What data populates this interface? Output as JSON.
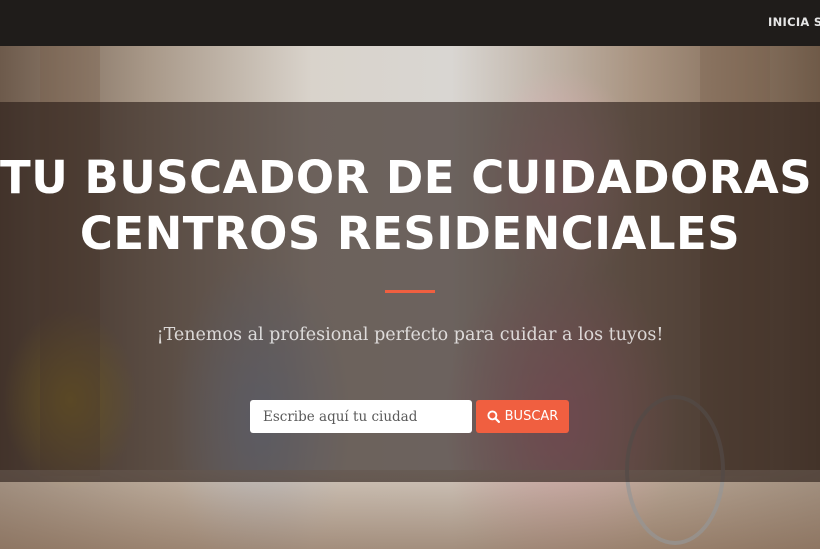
{
  "nav": {
    "link_label": "INICIA SESIÓN"
  },
  "hero": {
    "title_line1": "TU BUSCADOR DE CUIDADORAS Y",
    "title_line2": "CENTROS RESIDENCIALES",
    "subtitle": "¡Tenemos al profesional perfecto para cuidar a los tuyos!",
    "accent_color": "#f05f40"
  },
  "search": {
    "placeholder": "Escribe aquí tu ciudad",
    "value": "",
    "button_label": "BUSCAR",
    "button_icon": "search-icon"
  }
}
